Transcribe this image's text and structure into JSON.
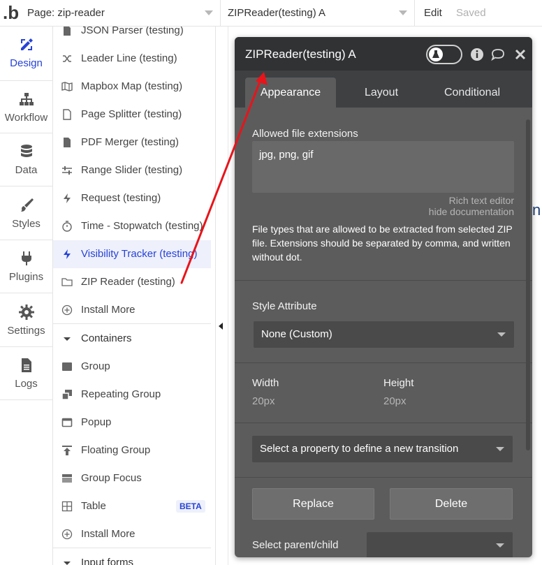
{
  "topbar": {
    "logo": ".b",
    "page_selector": "Page: zip-reader",
    "element_selector": "ZIPReader(testing) A",
    "edit": "Edit",
    "saved": "Saved"
  },
  "leftnav": [
    {
      "label": "Design",
      "icon": "design-icon",
      "active": true
    },
    {
      "label": "Workflow",
      "icon": "workflow-icon"
    },
    {
      "label": "Data",
      "icon": "database-icon"
    },
    {
      "label": "Styles",
      "icon": "brush-icon"
    },
    {
      "label": "Plugins",
      "icon": "plug-icon"
    },
    {
      "label": "Settings",
      "icon": "gear-icon"
    },
    {
      "label": "Logs",
      "icon": "document-icon"
    }
  ],
  "element_list": {
    "plugin_items": [
      {
        "label": "JSON Parser (testing)",
        "icon": "file-icon"
      },
      {
        "label": "Leader Line (testing)",
        "icon": "shuffle-icon"
      },
      {
        "label": "Mapbox Map (testing)",
        "icon": "map-icon"
      },
      {
        "label": "Page Splitter (testing)",
        "icon": "file-icon"
      },
      {
        "label": "PDF Merger (testing)",
        "icon": "file-icon"
      },
      {
        "label": "Range Slider (testing)",
        "icon": "sliders-icon"
      },
      {
        "label": "Request (testing)",
        "icon": "bolt-icon"
      },
      {
        "label": "Time - Stopwatch (testing)",
        "icon": "stopwatch-icon"
      },
      {
        "label": "Visibility Tracker (testing)",
        "icon": "bolt-icon",
        "selected": true
      },
      {
        "label": "ZIP Reader (testing)",
        "icon": "folder-icon"
      }
    ],
    "install_more_1": "Install More",
    "containers_header": "Containers",
    "container_items": [
      {
        "label": "Group",
        "icon": "group-icon"
      },
      {
        "label": "Repeating Group",
        "icon": "repeating-group-icon"
      },
      {
        "label": "Popup",
        "icon": "popup-icon"
      },
      {
        "label": "Floating Group",
        "icon": "floating-group-icon"
      },
      {
        "label": "Group Focus",
        "icon": "group-focus-icon"
      },
      {
        "label": "Table",
        "icon": "table-icon",
        "badge": "BETA"
      }
    ],
    "install_more_2": "Install More",
    "input_forms_header": "Input forms"
  },
  "editor": {
    "title": "ZIPReader(testing) A",
    "tabs": [
      "Appearance",
      "Layout",
      "Conditional"
    ],
    "allowed_ext_label": "Allowed file extensions",
    "allowed_ext_value": "jpg, png, gif",
    "rich_text_editor": "Rich text editor",
    "hide_documentation": "hide documentation",
    "documentation": "File types that are allowed to be extracted from selected ZIP file. Extensions should be separated by comma, and written without dot.",
    "style_attribute_label": "Style Attribute",
    "style_attribute_value": "None (Custom)",
    "width_label": "Width",
    "width_value": "20px",
    "height_label": "Height",
    "height_value": "20px",
    "transition_placeholder": "Select a property to define a new transition",
    "replace_button": "Replace",
    "delete_button": "Delete",
    "parent_child_label": "Select parent/child",
    "parent_child_value": ""
  },
  "colors": {
    "accent": "#2743d7",
    "annotation_arrow": "#e8141a",
    "editor_bg": "#5c5c5c",
    "editor_header": "#303234"
  }
}
